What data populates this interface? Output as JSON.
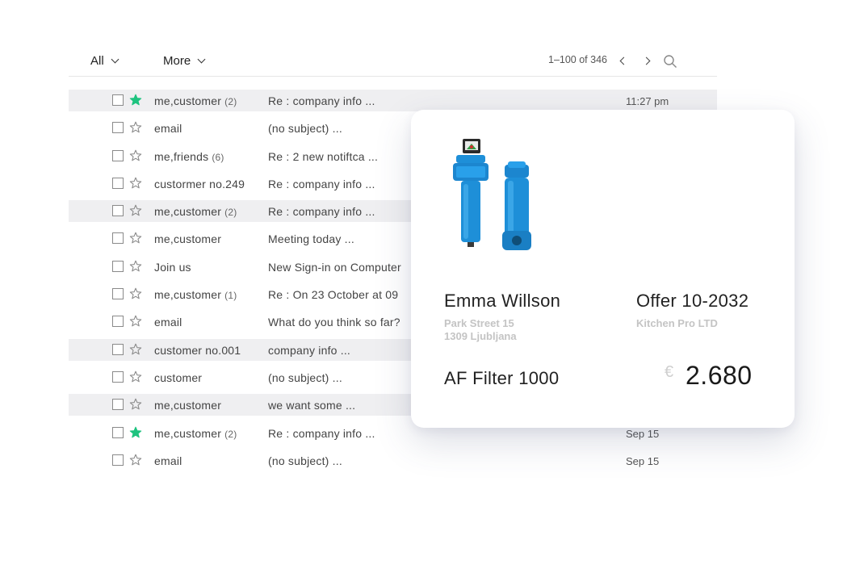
{
  "toolbar": {
    "all_label": "All",
    "more_label": "More",
    "pagination": "1–100 of 346"
  },
  "icons": {
    "prev": "chevron-left-icon",
    "next": "chevron-right-icon",
    "search": "search-icon",
    "star": "star-icon",
    "checkbox": "checkbox-icon"
  },
  "colors": {
    "star_active": "#1ec37f",
    "row_shaded": "#efeff1",
    "product": "#1e8fd8"
  },
  "emails": [
    {
      "sender": "me,customer",
      "count": "(2)",
      "subject": "Re : company info ...",
      "time": "11:27 pm",
      "starred": true,
      "shaded": true
    },
    {
      "sender": "email",
      "count": "",
      "subject": "(no subject) ...",
      "time": "",
      "starred": false,
      "shaded": false
    },
    {
      "sender": "me,friends",
      "count": "(6)",
      "subject": "Re : 2 new notiftca ...",
      "time": "",
      "starred": false,
      "shaded": false
    },
    {
      "sender": "custormer no.249",
      "count": "",
      "subject": "Re : company info ...",
      "time": "",
      "starred": false,
      "shaded": false
    },
    {
      "sender": "me,customer",
      "count": "(2)",
      "subject": "Re : company info ...",
      "time": "",
      "starred": false,
      "shaded": true
    },
    {
      "sender": "me,customer",
      "count": "",
      "subject": "Meeting today ...",
      "time": "",
      "starred": false,
      "shaded": false
    },
    {
      "sender": "Join us",
      "count": "",
      "subject": "New Sign-in on Computer",
      "time": "",
      "starred": false,
      "shaded": false
    },
    {
      "sender": "me,customer",
      "count": "(1)",
      "subject": "Re : On 23 October at 09",
      "time": "",
      "starred": false,
      "shaded": false
    },
    {
      "sender": "email",
      "count": "",
      "subject": "What do you think so far?",
      "time": "",
      "starred": false,
      "shaded": false
    },
    {
      "sender": "customer no.001",
      "count": "",
      "subject": "company info ...",
      "time": "",
      "starred": false,
      "shaded": true
    },
    {
      "sender": "customer",
      "count": "",
      "subject": "(no subject) ...",
      "time": "",
      "starred": false,
      "shaded": false
    },
    {
      "sender": "me,customer",
      "count": "",
      "subject": "we want some ...",
      "time": "",
      "starred": false,
      "shaded": true
    },
    {
      "sender": "me,customer",
      "count": "(2)",
      "subject": "Re : company info ...",
      "time": "Sep 15",
      "starred": true,
      "shaded": false
    },
    {
      "sender": "email",
      "count": "",
      "subject": "(no subject) ...",
      "time": "Sep 15",
      "starred": false,
      "shaded": false
    }
  ],
  "offer_card": {
    "customer_name": "Emma Willson",
    "address_line1": "Park Street 15",
    "address_line2": "1309 Ljubljana",
    "offer_number": "Offer 10-2032",
    "company": "Kitchen Pro LTD",
    "product_name": "AF Filter 1000",
    "currency_symbol": "€",
    "price": "2.680"
  }
}
